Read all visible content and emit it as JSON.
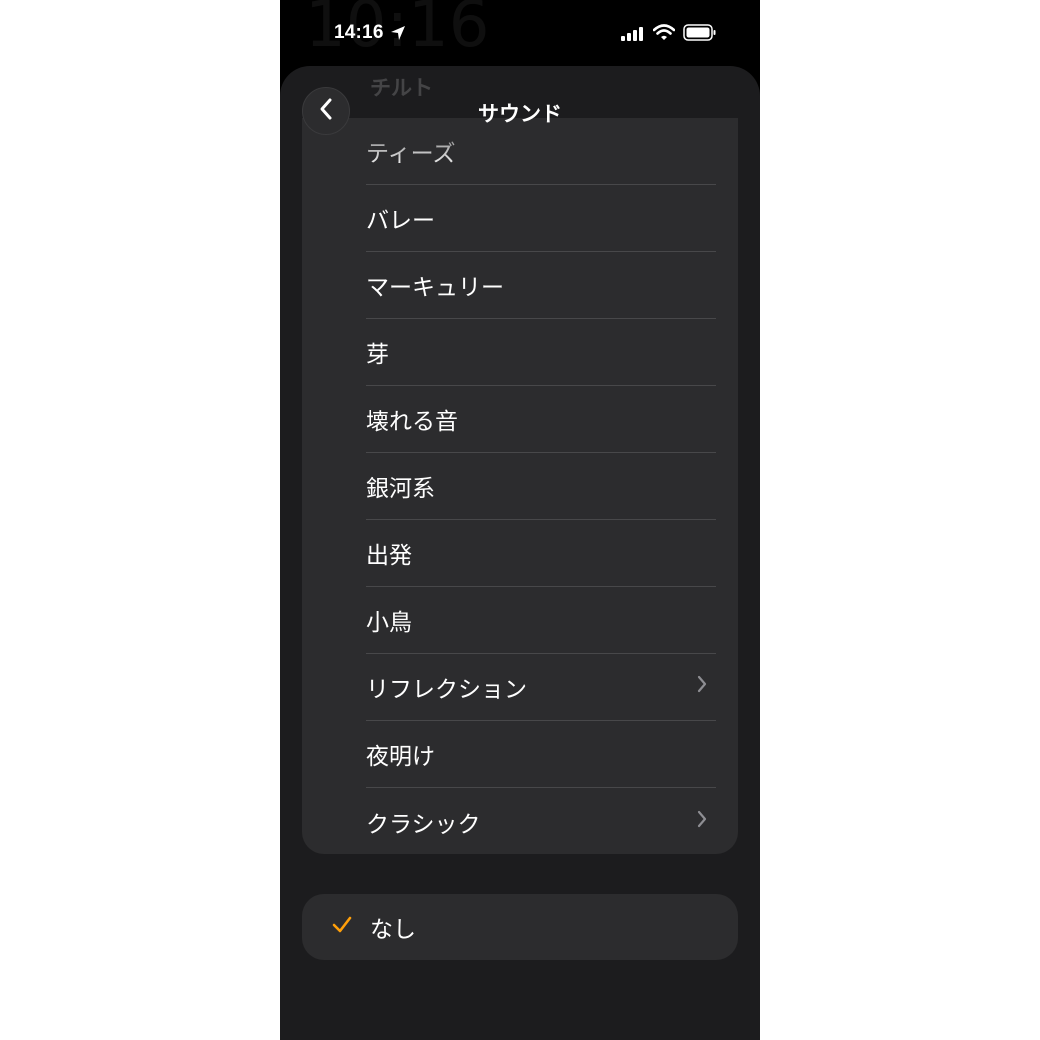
{
  "status_bar": {
    "time": "14:16",
    "background_clock": "10:16"
  },
  "header": {
    "ghost_text": "チルト",
    "title": "サウンド"
  },
  "sound_list": [
    {
      "label": "ティーズ",
      "has_chevron": false
    },
    {
      "label": "バレー",
      "has_chevron": false
    },
    {
      "label": "マーキュリー",
      "has_chevron": false
    },
    {
      "label": "芽",
      "has_chevron": false
    },
    {
      "label": "壊れる音",
      "has_chevron": false
    },
    {
      "label": "銀河系",
      "has_chevron": false
    },
    {
      "label": "出発",
      "has_chevron": false
    },
    {
      "label": "小鳥",
      "has_chevron": false
    },
    {
      "label": "リフレクション",
      "has_chevron": true
    },
    {
      "label": "夜明け",
      "has_chevron": false
    },
    {
      "label": "クラシック",
      "has_chevron": true
    }
  ],
  "none_option": {
    "label": "なし",
    "selected": true
  },
  "colors": {
    "accent": "#ff9f0a",
    "card": "#2c2c2e",
    "sheet": "#1c1c1e"
  }
}
